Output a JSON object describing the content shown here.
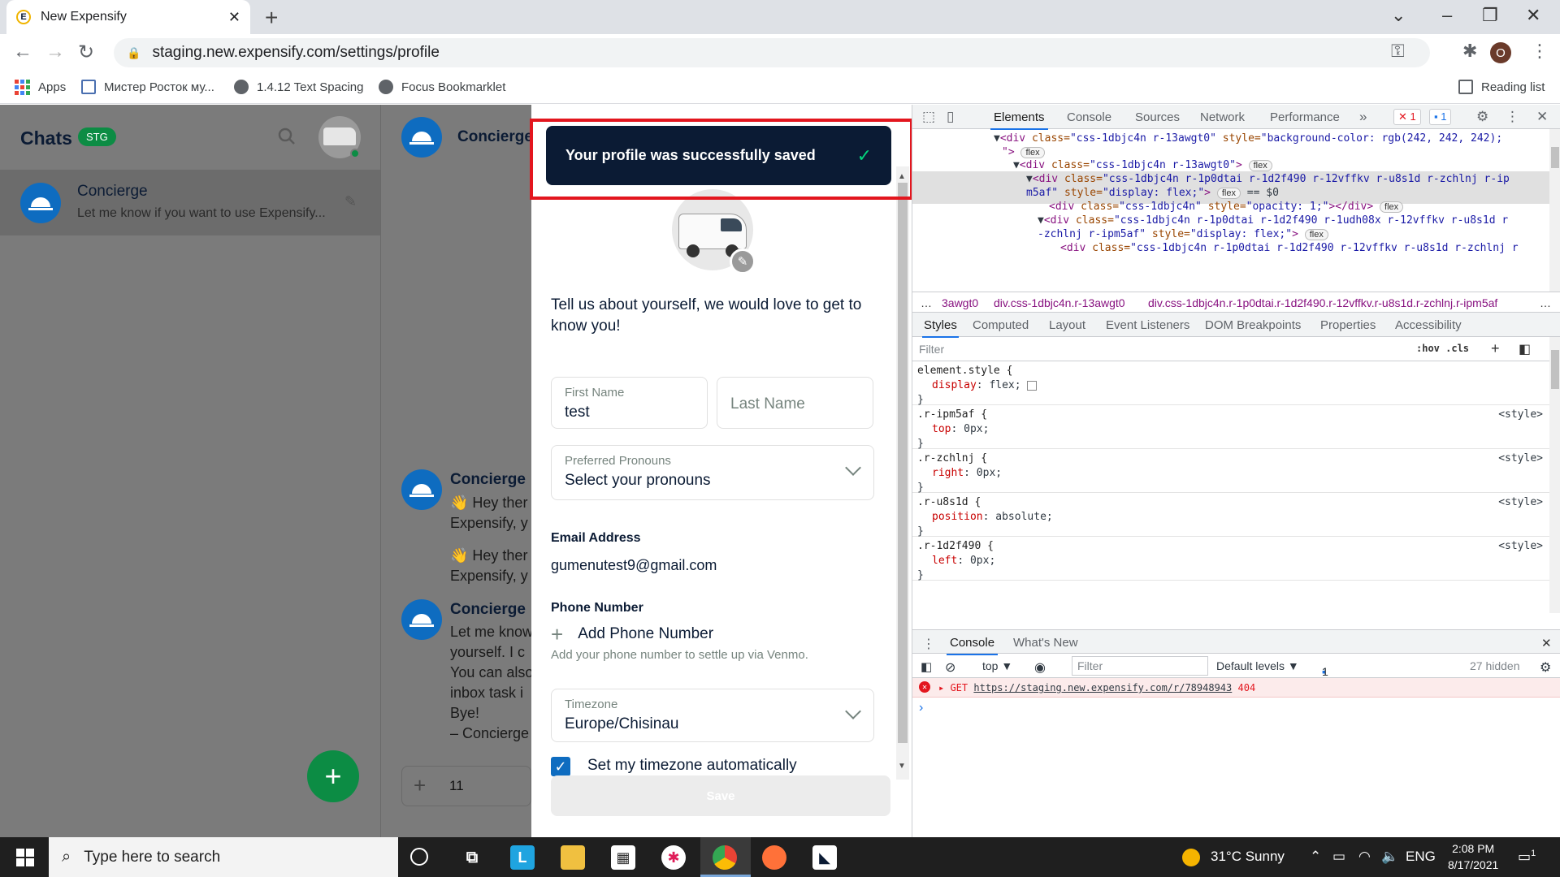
{
  "browser": {
    "tab_title": "New Expensify",
    "favicon_letter": "E",
    "url": "staging.new.expensify.com/settings/profile",
    "profile_initial": "O",
    "bookmarks": [
      "Apps",
      "Мистер Росток му...",
      "1.4.12 Text Spacing",
      "Focus Bookmarklet"
    ],
    "reading_list": "Reading list"
  },
  "sidebar": {
    "title": "Chats",
    "badge": "STG",
    "chat": {
      "name": "Concierge",
      "preview": "Let me know if you want to use Expensify..."
    }
  },
  "chatview": {
    "header_name": "Concierge",
    "messages": [
      {
        "name": "Concierge",
        "lines": [
          "👋 Hey ther",
          "Expensify, y",
          "👋 Hey ther",
          "Expensify, y"
        ]
      },
      {
        "name": "Concierge",
        "lines": [
          "Let me know",
          "yourself. I c",
          "You can also",
          "inbox task i",
          "Bye!",
          "– Concierge"
        ]
      }
    ],
    "composer_value": "11"
  },
  "toast": {
    "message": "Your profile was successfully saved",
    "check": "✓"
  },
  "profile": {
    "intro": "Tell us about yourself, we would love to get to know you!",
    "first_name": {
      "label": "First Name",
      "value": "test"
    },
    "last_name": {
      "placeholder": "Last Name"
    },
    "pronouns": {
      "label": "Preferred Pronouns",
      "value": "Select your pronouns"
    },
    "email": {
      "label": "Email Address",
      "value": "gumenutest9@gmail.com"
    },
    "phone": {
      "label": "Phone Number",
      "add_label": "Add Phone Number",
      "hint": "Add your phone number to settle up via Venmo."
    },
    "timezone": {
      "label": "Timezone",
      "value": "Europe/Chisinau"
    },
    "auto_timezone_label": "Set my timezone automatically",
    "save_label": "Save"
  },
  "devtools": {
    "tabs": [
      "Elements",
      "Console",
      "Sources",
      "Network",
      "Performance"
    ],
    "error_count": "1",
    "message_count": "1",
    "breadcrumbs": [
      "…",
      "3awgt0",
      "div.css-1dbjc4n.r-13awgt0",
      "div.css-1dbjc4n.r-1p0dtai.r-1d2f490.r-12vffkv.r-u8s1d.r-zchlnj.r-ipm5af",
      "…"
    ],
    "styles_tabs": [
      "Styles",
      "Computed",
      "Layout",
      "Event Listeners",
      "DOM Breakpoints",
      "Properties",
      "Accessibility"
    ],
    "filter_placeholder": "Filter",
    "filter_opts": ":hov  .cls",
    "rules": [
      {
        "selector": "element.style {",
        "prop": "display",
        "value": "flex;",
        "source": ""
      },
      {
        "selector": ".r-ipm5af {",
        "prop": "top",
        "value": "0px;",
        "source": "<style>"
      },
      {
        "selector": ".r-zchlnj {",
        "prop": "right",
        "value": "0px;",
        "source": "<style>"
      },
      {
        "selector": ".r-u8s1d {",
        "prop": "position",
        "value": "absolute;",
        "source": "<style>"
      },
      {
        "selector": ".r-1d2f490 {",
        "prop": "left",
        "value": "0px;",
        "source": "<style>"
      }
    ],
    "console_tabs": [
      "Console",
      "What's New"
    ],
    "console_context": "top ▼",
    "console_filter": "Filter",
    "default_levels": "Default levels ▼",
    "issues": "1 Issue:",
    "issues_count": "1",
    "hidden": "27 hidden",
    "error_method": "GET",
    "error_url": "https://staging.new.expensify.com/r/78948943",
    "error_status": "404",
    "prompt": "›"
  },
  "taskbar": {
    "search_placeholder": "Type here to search",
    "weather": "31°C  Sunny",
    "lang": "ENG",
    "time": "2:08 PM",
    "date": "8/17/2021",
    "notif_count": "1"
  }
}
